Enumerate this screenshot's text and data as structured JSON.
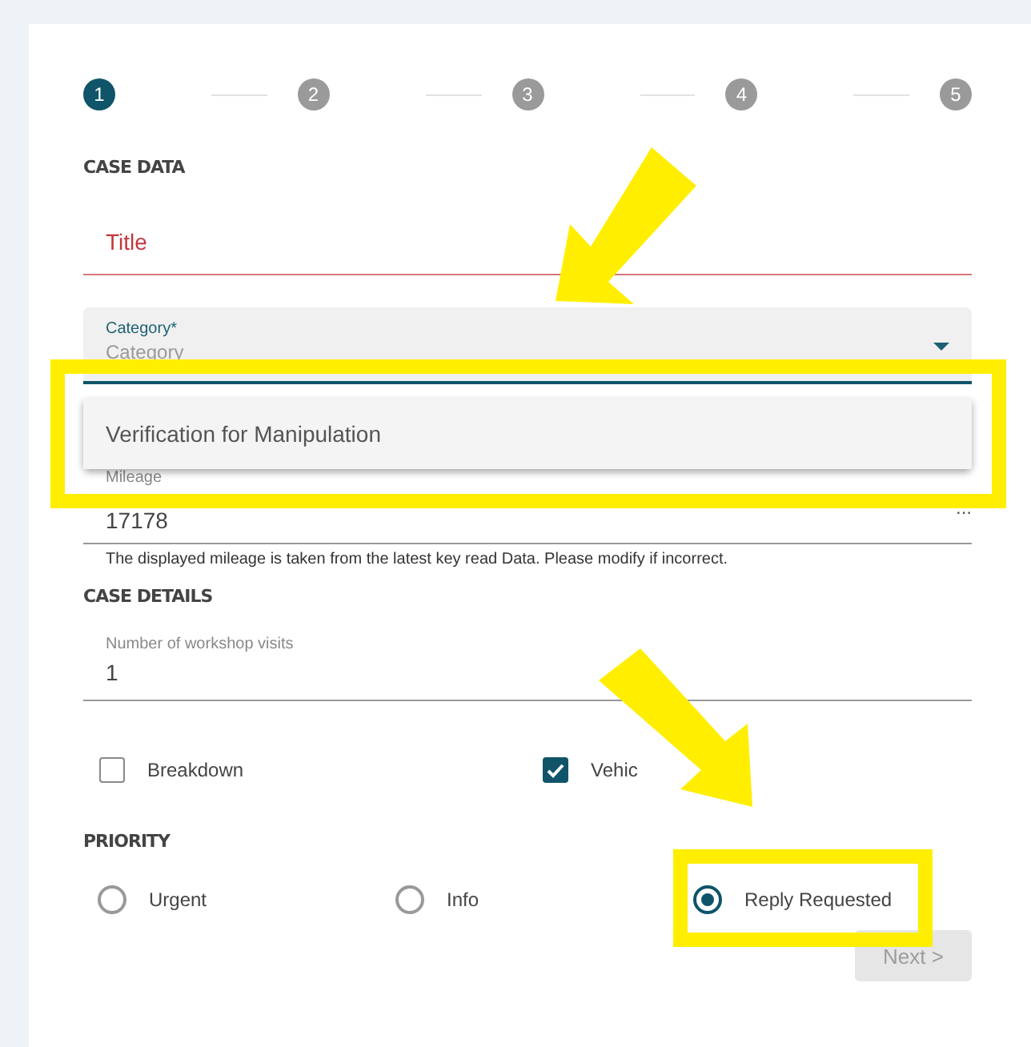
{
  "stepper": [
    {
      "label": "1",
      "selected": true
    },
    {
      "label": "2",
      "selected": false
    },
    {
      "label": "3",
      "selected": false
    },
    {
      "label": "4",
      "selected": false
    },
    {
      "label": "5",
      "selected": false
    }
  ],
  "case_data": {
    "heading": "CASE DATA",
    "title_field": {
      "placeholder": "Title",
      "invalid": true
    },
    "category_field": {
      "label": "Category*",
      "placeholder": "Category",
      "expanded": true,
      "options": [
        "Verification for Manipulation"
      ]
    },
    "mileage_field": {
      "label": "Mileage",
      "value": "17178",
      "suffix": "...",
      "hint": "The displayed mileage is taken from the latest key read Data. Please modify if incorrect."
    }
  },
  "case_details": {
    "heading": "CASE DETAILS",
    "visits_field": {
      "label": "Number of workshop visits",
      "value": "1"
    },
    "checkboxes": [
      {
        "label": "Breakdown",
        "checked": false
      },
      {
        "label": "Vehic",
        "checked": true
      }
    ]
  },
  "priority": {
    "heading": "PRIORITY",
    "options": [
      {
        "label": "Urgent",
        "selected": false
      },
      {
        "label": "Info",
        "selected": false
      },
      {
        "label": "Reply Requested",
        "selected": true
      }
    ]
  },
  "next_button": {
    "label": "Next >",
    "disabled": true
  }
}
